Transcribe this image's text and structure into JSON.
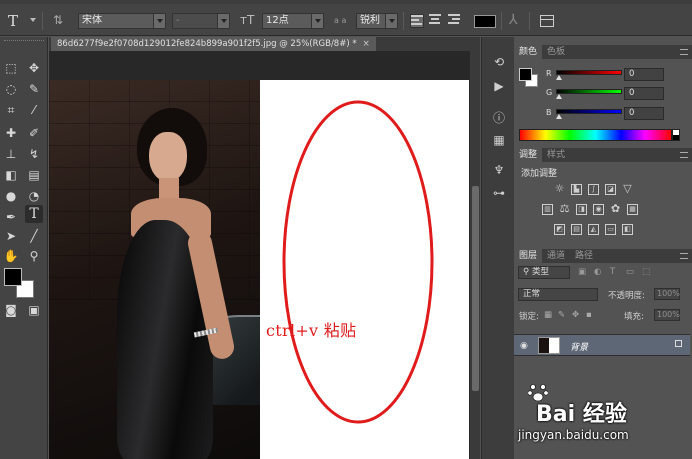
{
  "options_bar": {
    "tool_glyph": "T",
    "font_family": "宋体",
    "font_style": "-",
    "font_size": "12点",
    "aa_label": "a a",
    "antialias": "锐利",
    "text_color": "#000000"
  },
  "document": {
    "tab_title": "86d6277f9e2f0708d129012fe824b899a901f2f5.jpg @ 25%(RGB/8#) *",
    "close_glyph": "×",
    "annotation_text": "ctrl+v 粘贴",
    "annotation_color": "#e01b1b"
  },
  "color_panel": {
    "tabs": [
      "颜色",
      "色板"
    ],
    "channels": [
      {
        "label": "R",
        "value": "0"
      },
      {
        "label": "G",
        "value": "0"
      },
      {
        "label": "B",
        "value": "0"
      }
    ]
  },
  "adjust_panel": {
    "tabs": [
      "调整",
      "样式"
    ],
    "title": "添加调整"
  },
  "layers_panel": {
    "tabs": [
      "图层",
      "通道",
      "路径"
    ],
    "filter_kind": "类型",
    "blend_mode": "正常",
    "opacity_label": "不透明度:",
    "opacity_value": "100%",
    "lock_label": "锁定:",
    "fill_label": "填充:",
    "fill_value": "100%",
    "layer_name": "背景"
  },
  "watermark": {
    "brand": "Bai 经验",
    "url": "jingyan.baidu.com"
  }
}
